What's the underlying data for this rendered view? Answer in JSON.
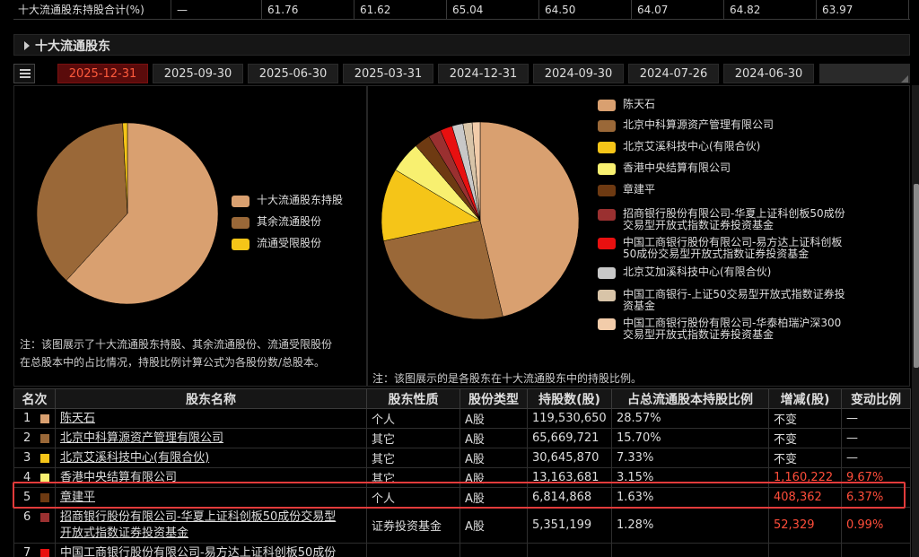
{
  "summary_row": {
    "label": "十大流通股东持股合计(%)",
    "cells": [
      "—",
      "61.76",
      "61.62",
      "65.04",
      "64.50",
      "64.07",
      "64.82",
      "63.97"
    ]
  },
  "section_title": "十大流通股东",
  "tabs": [
    "2025-12-31",
    "2025-09-30",
    "2025-06-30",
    "2025-03-31",
    "2024-12-31",
    "2024-09-30",
    "2024-07-26",
    "2024-06-30"
  ],
  "active_tab": "2025-12-31",
  "left_chart": {
    "note": "注：该图展示了十大流通股东持股、其余流通股份、流通受限股份在总股本中的占比情况，持股比例计算公式为各股份数/总股本。",
    "note_lines": [
      "注：该图展示了十大流通股东持股、其余流通股份、流通受限股份",
      "在总股本中的占比情况，持股比例计算公式为各股份数/总股本。"
    ],
    "legend": [
      "十大流通股东持股",
      "其余流通股份",
      "流通受限股份"
    ]
  },
  "right_chart": {
    "note": "注：该图展示的是各股东在十大流通股东中的持股比例。",
    "legend": [
      [
        "陈天石"
      ],
      [
        "北京中科算源资产管理有限公司"
      ],
      [
        "北京艾溪科技中心(有限合伙)"
      ],
      [
        "香港中央结算有限公司"
      ],
      [
        "章建平"
      ],
      [
        "招商银行股份有限公司-华夏上证科创板50成份",
        "交易型开放式指数证券投资基金"
      ],
      [
        "中国工商银行股份有限公司-易方达上证科创板",
        "50成份交易型开放式指数证券投资基金"
      ],
      [
        "北京艾加溪科技中心(有限合伙)"
      ],
      [
        "中国工商银行-上证50交易型开放式指数证券投",
        "资基金"
      ],
      [
        "中国工商银行股份有限公司-华泰柏瑞沪深300",
        "交易型开放式指数证券投资基金"
      ]
    ]
  },
  "chart_data": [
    {
      "type": "pie",
      "labels": [
        "十大流通股东持股",
        "其余流通股份",
        "流通受限股份"
      ],
      "values": [
        61.76,
        37.4,
        0.84
      ],
      "colors": [
        "#d9a070",
        "#9a6838",
        "#f5c518"
      ]
    },
    {
      "type": "pie",
      "labels": [
        "陈天石",
        "北京中科算源资产管理有限公司",
        "北京艾溪科技中心(有限合伙)",
        "香港中央结算有限公司",
        "章建平",
        "招商银行股份有限公司-华夏上证科创板50成份交易型开放式指数证券投资基金",
        "中国工商银行股份有限公司-易方达上证科创板50成份交易型开放式指数证券投资基金",
        "北京艾加溪科技中心(有限合伙)",
        "中国工商银行-上证50交易型开放式指数证券投资基金",
        "中国工商银行股份有限公司-华泰柏瑞沪深300交易型开放式指数证券投资基金"
      ],
      "values": [
        46.3,
        25.4,
        11.9,
        5.1,
        2.6,
        2.1,
        2.0,
        1.8,
        1.5,
        1.3
      ],
      "colors": [
        "#d9a070",
        "#9a6838",
        "#f5c518",
        "#f8f070",
        "#6e3a12",
        "#9a3030",
        "#e81010",
        "#c8c8c8",
        "#d8c4a8",
        "#f2ccaa"
      ]
    }
  ],
  "table": {
    "headers": [
      "名次",
      "股东名称",
      "股东性质",
      "股份类型",
      "持股数(股)",
      "占总流通股本持股比例",
      "增减(股)",
      "变动比例"
    ],
    "rows": [
      {
        "rank": "1",
        "color": "#d9a070",
        "name": "陈天石",
        "nature": "个人",
        "type": "A股",
        "shares": "119,530,650",
        "ratio": "28.57%",
        "change": "不变",
        "change_pct": "—"
      },
      {
        "rank": "2",
        "color": "#9a6838",
        "name": "北京中科算源资产管理有限公司",
        "nature": "其它",
        "type": "A股",
        "shares": "65,669,721",
        "ratio": "15.70%",
        "change": "不变",
        "change_pct": "—"
      },
      {
        "rank": "3",
        "color": "#f5c518",
        "name": "北京艾溪科技中心(有限合伙)",
        "nature": "其它",
        "type": "A股",
        "shares": "30,645,870",
        "ratio": "7.33%",
        "change": "不变",
        "change_pct": "—"
      },
      {
        "rank": "4",
        "color": "#f8f070",
        "name": "香港中央结算有限公司",
        "nature": "其它",
        "type": "A股",
        "shares": "13,163,681",
        "ratio": "3.15%",
        "change": "1,160,222",
        "change_pct": "9.67%"
      },
      {
        "rank": "5",
        "color": "#6e3a12",
        "name": "章建平",
        "nature": "个人",
        "type": "A股",
        "shares": "6,814,868",
        "ratio": "1.63%",
        "change": "408,362",
        "change_pct": "6.37%"
      },
      {
        "rank": "6",
        "color": "#9a3030",
        "name": "招商银行股份有限公司-华夏上证科创板50成份交易型开放式指数证券投资基金",
        "name_lines": [
          "招商银行股份有限公司-华夏上证科创板50成份交易型",
          "开放式指数证券投资基金"
        ],
        "nature": "证券投资基金",
        "type": "A股",
        "shares": "5,351,199",
        "ratio": "1.28%",
        "change": "52,329",
        "change_pct": "0.99%"
      },
      {
        "rank": "7",
        "color": "#e81010",
        "name": "中国工商银行股份有限公司-易方达上证科创板50成份",
        "nature": "",
        "type": "",
        "shares": "",
        "ratio": "",
        "change": "",
        "change_pct": ""
      }
    ]
  }
}
